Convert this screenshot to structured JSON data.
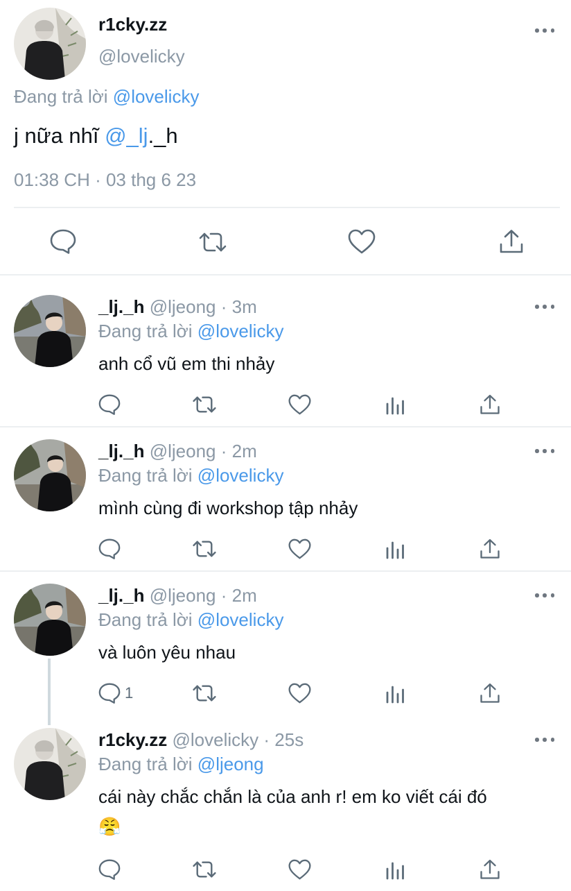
{
  "main_tweet": {
    "display_name": "r1cky.zz",
    "handle": "@lovelicky",
    "replying_prefix": "Đang trả lời",
    "replying_to": "@lovelicky",
    "text_prefix": "j nữa nhĩ",
    "mention": "@_lj",
    "text_suffix": "._h",
    "timestamp": "01:38 CH · 03 thg 6 23"
  },
  "replies": [
    {
      "display_name": "_lj._h",
      "handle": "@ljeong",
      "time": "· 3m",
      "replying_prefix": "Đang trả lời",
      "replying_to": "@lovelicky",
      "text": "anh cổ vũ em thi nhảy",
      "reply_count": ""
    },
    {
      "display_name": "_lj._h",
      "handle": "@ljeong",
      "time": "· 2m",
      "replying_prefix": "Đang trả lời",
      "replying_to": "@lovelicky",
      "text": "mình cùng đi workshop tập nhảy",
      "reply_count": ""
    },
    {
      "display_name": "_lj._h",
      "handle": "@ljeong",
      "time": "· 2m",
      "replying_prefix": "Đang trả lời",
      "replying_to": "@lovelicky",
      "text": "và luôn yêu nhau",
      "reply_count": "1"
    },
    {
      "display_name": "r1cky.zz",
      "handle": "@lovelicky",
      "time": "· 25s",
      "replying_prefix": "Đang trả lời",
      "replying_to": "@ljeong",
      "text_line1": "cái này chắc chắn là của anh r! em ko viết cái đó",
      "text_line2": "😤",
      "reply_count": ""
    }
  ],
  "icons": {
    "reply": "speech-bubble-icon",
    "retweet": "retweet-icon",
    "like": "heart-icon",
    "views": "bar-chart-icon",
    "share": "share-icon",
    "more": "more-dots-icon"
  },
  "colors": {
    "link": "#4a99e9",
    "secondary_text": "#8b98a5",
    "icon": "#5b6b78"
  }
}
